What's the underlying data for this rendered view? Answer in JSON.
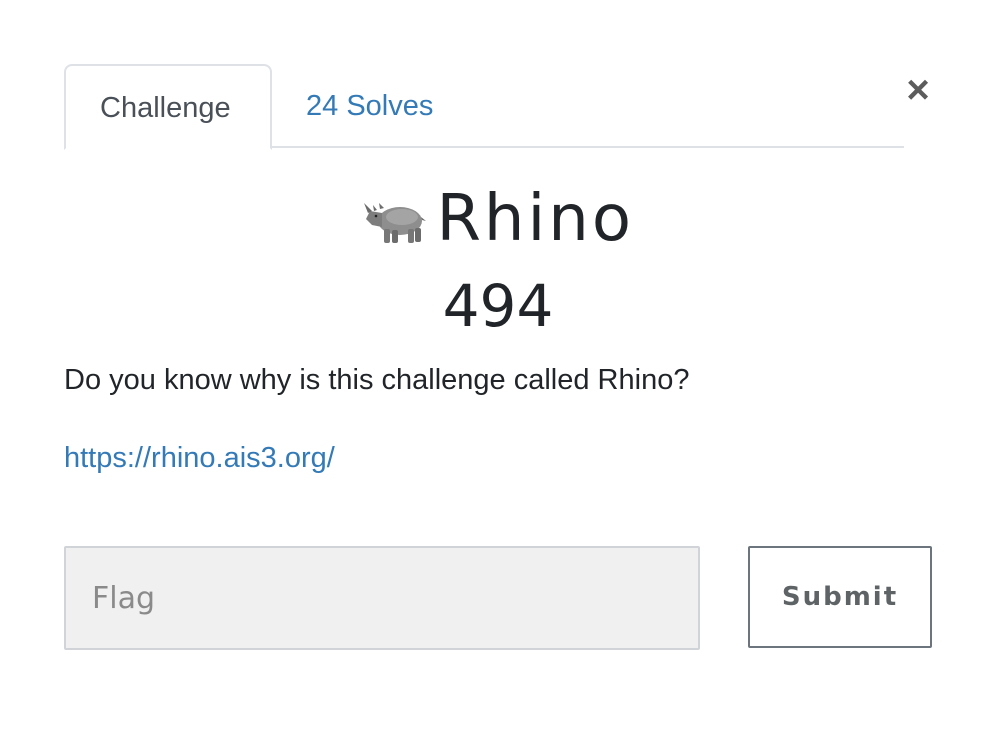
{
  "tabs": [
    {
      "label": "Challenge",
      "active": true
    },
    {
      "label": "24 Solves",
      "active": false
    }
  ],
  "close": {
    "glyph": "×",
    "icon": "close-icon"
  },
  "challenge": {
    "icon": "rhino-icon",
    "name": "Rhino",
    "value": "494",
    "description": "Do you know why is this challenge called Rhino?",
    "link": "https://rhino.ais3.org/"
  },
  "form": {
    "flag_placeholder": "Flag",
    "flag_value": "",
    "submit_label": "Submit"
  },
  "colors": {
    "link": "#337ab7",
    "border": "#dee2e6",
    "input_bg": "#f0f0f0"
  }
}
